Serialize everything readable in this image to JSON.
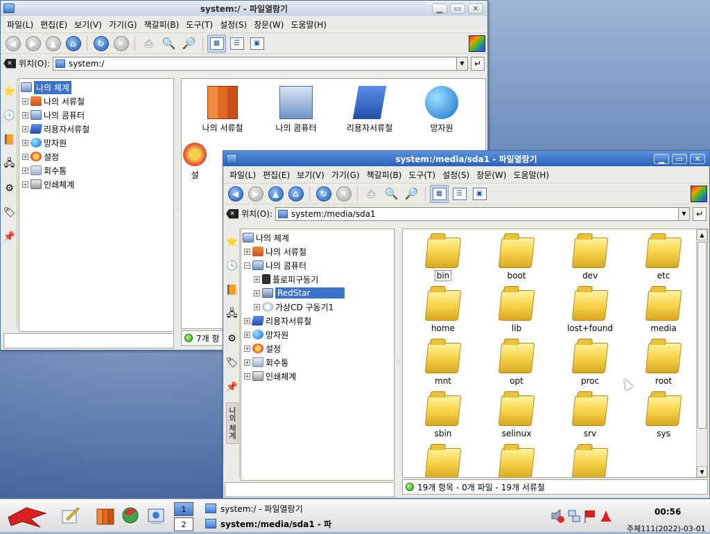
{
  "desktop": {},
  "window_back": {
    "title": "system:/ - 파일열람기",
    "menu": [
      "파일(L)",
      "편집(E)",
      "보기(V)",
      "가기(G)",
      "책갈피(B)",
      "도구(T)",
      "설정(S)",
      "창문(W)",
      "도움말(H)"
    ],
    "location_label": "위치(O):",
    "location_value": "system:/",
    "tree": [
      {
        "label": "나의 체계",
        "icon": "computer-icon",
        "selected": true
      },
      {
        "label": "나의 서류철",
        "icon": "documents-icon"
      },
      {
        "label": "나의 콤퓨터",
        "icon": "computer-icon"
      },
      {
        "label": "리용자서류철",
        "icon": "user-folder-icon"
      },
      {
        "label": "망자원",
        "icon": "network-icon"
      },
      {
        "label": "설정",
        "icon": "settings-icon"
      },
      {
        "label": "회수통",
        "icon": "trash-icon"
      },
      {
        "label": "인쇄체계",
        "icon": "printer-icon"
      }
    ],
    "icons": [
      "나의 서류철",
      "나의 콤퓨터",
      "리용자서류철",
      "망자원",
      "설"
    ],
    "status": "7개 항"
  },
  "window_front": {
    "title": "system:/media/sda1 - 파일열람기",
    "menu": [
      "파일(L)",
      "편집(E)",
      "보기(V)",
      "가기(G)",
      "책갈피(B)",
      "도구(T)",
      "설정(S)",
      "창문(W)",
      "도움말(H)"
    ],
    "location_label": "위치(O):",
    "location_value": "system:/media/sda1",
    "side_tab_text": "나의 체계",
    "tree": [
      {
        "label": "나의 체계",
        "level": 0
      },
      {
        "label": "나의 서류철",
        "level": 1
      },
      {
        "label": "나의 콤퓨터",
        "level": 1
      },
      {
        "label": "플로피구동기",
        "level": 2
      },
      {
        "label": "RedStar",
        "level": 2,
        "selected": true
      },
      {
        "label": "가상CD 구동기1",
        "level": 2
      },
      {
        "label": "리용자서류철",
        "level": 1
      },
      {
        "label": "망자원",
        "level": 1
      },
      {
        "label": "설정",
        "level": 1
      },
      {
        "label": "회수통",
        "level": 1
      },
      {
        "label": "인쇄체계",
        "level": 1
      }
    ],
    "folders": [
      "bin",
      "boot",
      "dev",
      "etc",
      "home",
      "lib",
      "lost+found",
      "media",
      "mnt",
      "opt",
      "proc",
      "root",
      "sbin",
      "selinux",
      "srv",
      "sys"
    ],
    "status": "19개 항목 - 0개 파일 - 19개 서류철"
  },
  "taskbar": {
    "pager": [
      "1",
      "2"
    ],
    "tasks": [
      "system:/ - 파일열람기",
      "system:/media/sda1 - 파"
    ],
    "clock": "00:56",
    "date": "주체111(2022)-03-01"
  }
}
